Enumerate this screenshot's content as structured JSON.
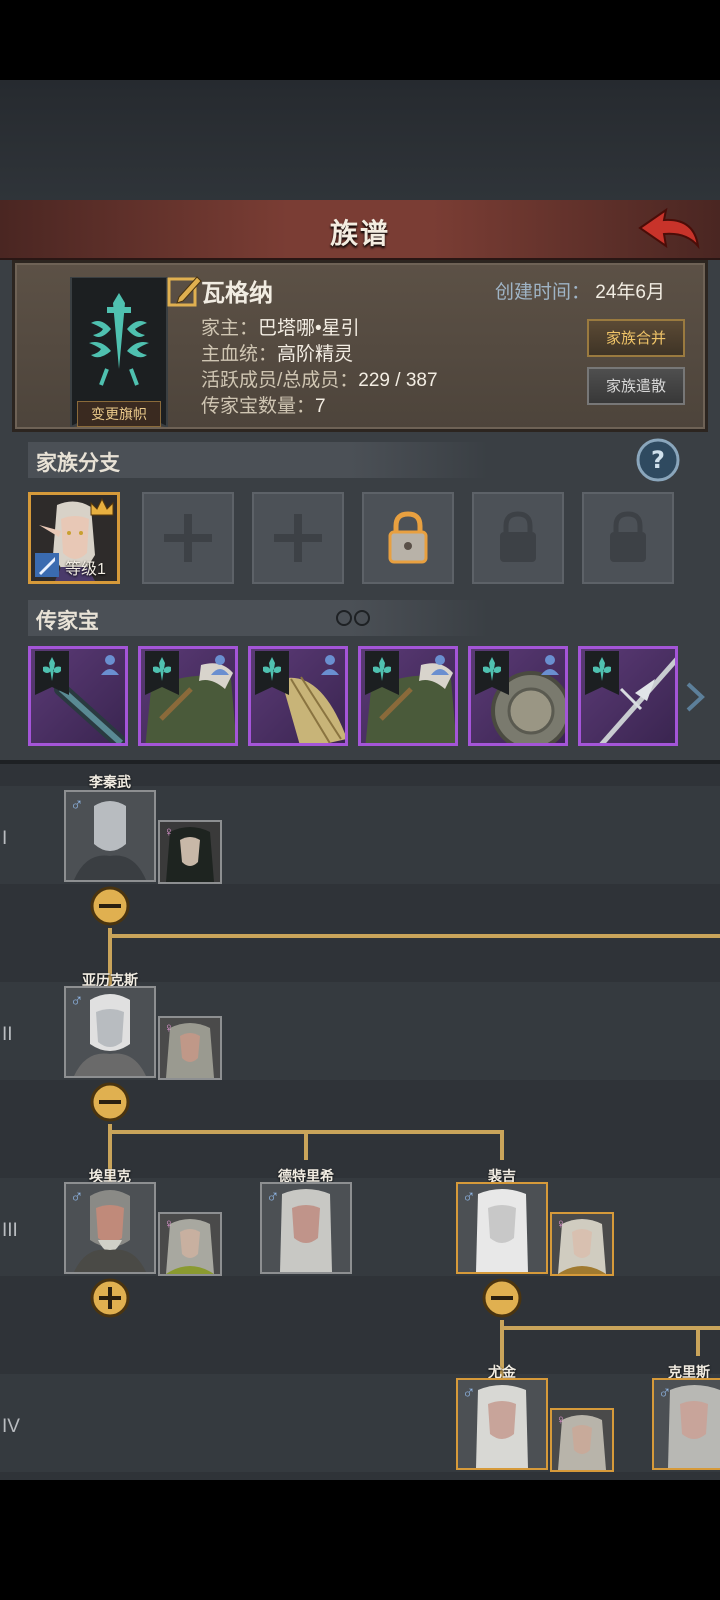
{
  "title": "族谱",
  "family": {
    "name": "瓦格纳",
    "created_label": "创建时间：",
    "created_value": "24年6月",
    "head_label": "家主：",
    "head_value": "巴塔哪•星引",
    "bloodline_label": "主血统：",
    "bloodline_value": "高阶精灵",
    "members_label": "活跃成员/总成员：",
    "members_value": "229 / 387",
    "heirloom_count_label": "传家宝数量：",
    "heirloom_count_value": "7",
    "banner_btn": "变更旗帜",
    "merge_btn": "家族合并",
    "dissolve_btn": "家族遣散"
  },
  "branches": {
    "header": "家族分支",
    "level_label": "等级1",
    "slots": [
      "active",
      "empty",
      "empty",
      "locked-highlight",
      "locked",
      "locked"
    ]
  },
  "heirlooms": {
    "header": "传家宝",
    "items": [
      "staff",
      "cloak",
      "fan",
      "cloak",
      "shield",
      "spear"
    ]
  },
  "tree": {
    "generations": [
      "I",
      "II",
      "III",
      "IV"
    ],
    "members": {
      "g1": "李秦武",
      "g2": "亚历克斯",
      "g3a": "埃里克",
      "g3b": "德特里希",
      "g3c": "裴吉",
      "g4a": "尤金",
      "g4b": "克里斯"
    }
  },
  "colors": {
    "accent_gold": "#c9a45a",
    "epic_purple": "#a455d8",
    "title_red": "#7a3d34"
  }
}
